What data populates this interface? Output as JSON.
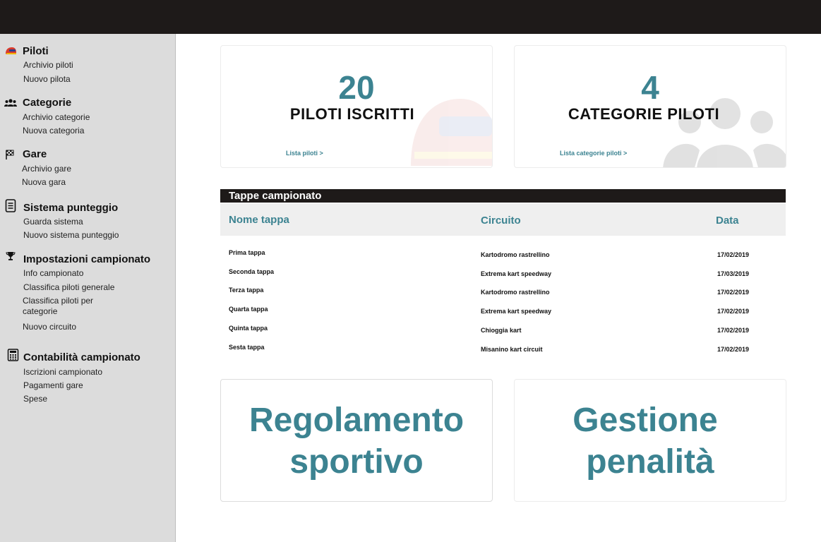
{
  "sidebar": {
    "sections": [
      {
        "icon": "helmet-icon",
        "title": "Piloti",
        "items": [
          "Archivio piloti",
          "Nuovo pilota"
        ]
      },
      {
        "icon": "users-icon",
        "title": "Categorie",
        "items": [
          "Archivio categorie",
          "Nuova categoria"
        ]
      },
      {
        "icon": "checkered-flag-icon",
        "title": "Gare",
        "items": [
          "Archivio gare",
          "Nuova gara"
        ]
      },
      {
        "icon": "list-document-icon",
        "title": "Sistema punteggio",
        "items": [
          "Guarda sistema",
          "Nuovo sistema punteggio"
        ]
      },
      {
        "icon": "trophy-icon",
        "title": "Impostazioni campionato",
        "items": [
          "Info campionato",
          "Classifica piloti generale",
          "Classifica piloti per",
          "categorie",
          "Nuovo circuito"
        ]
      },
      {
        "icon": "calculator-icon",
        "title": "Contabilità campionato",
        "items": [
          "Iscrizioni campionato",
          "Pagamenti gare",
          "Spese"
        ]
      }
    ]
  },
  "cards": {
    "piloti": {
      "value": "20",
      "label": "PILOTI ISCRITTI",
      "link": "Lista piloti  >"
    },
    "categorie": {
      "value": "4",
      "label": "CATEGORIE PILOTI",
      "link": "Lista categorie piloti  >"
    }
  },
  "table": {
    "title": "Tappe campionato",
    "columns": [
      "Nome tappa",
      "Circuito",
      "Data"
    ],
    "rows": [
      {
        "name": "Prima tappa",
        "circuit": "Kartodromo rastrellino",
        "date": "17/02/2019"
      },
      {
        "name": "Seconda tappa",
        "circuit": "Extrema kart speedway",
        "date": "17/03/2019"
      },
      {
        "name": "Terza tappa",
        "circuit": "Kartodromo rastrellino",
        "date": "17/02/2019"
      },
      {
        "name": "Quarta tappa",
        "circuit": "Extrema kart speedway",
        "date": "17/02/2019"
      },
      {
        "name": "Quinta tappa",
        "circuit": "Chioggia kart",
        "date": "17/02/2019"
      },
      {
        "name": "Sesta tappa",
        "circuit": "Misanino kart circuit",
        "date": "17/02/2019"
      }
    ]
  },
  "bottom_cards": {
    "regolamento": {
      "line1": "Regolamento",
      "line2": "sportivo"
    },
    "penalita": {
      "line1": "Gestione",
      "line2": "penalità"
    }
  },
  "colors": {
    "accent": "#3c8391",
    "topbar": "#1e1a19",
    "sidebar": "#dcdcdc"
  }
}
